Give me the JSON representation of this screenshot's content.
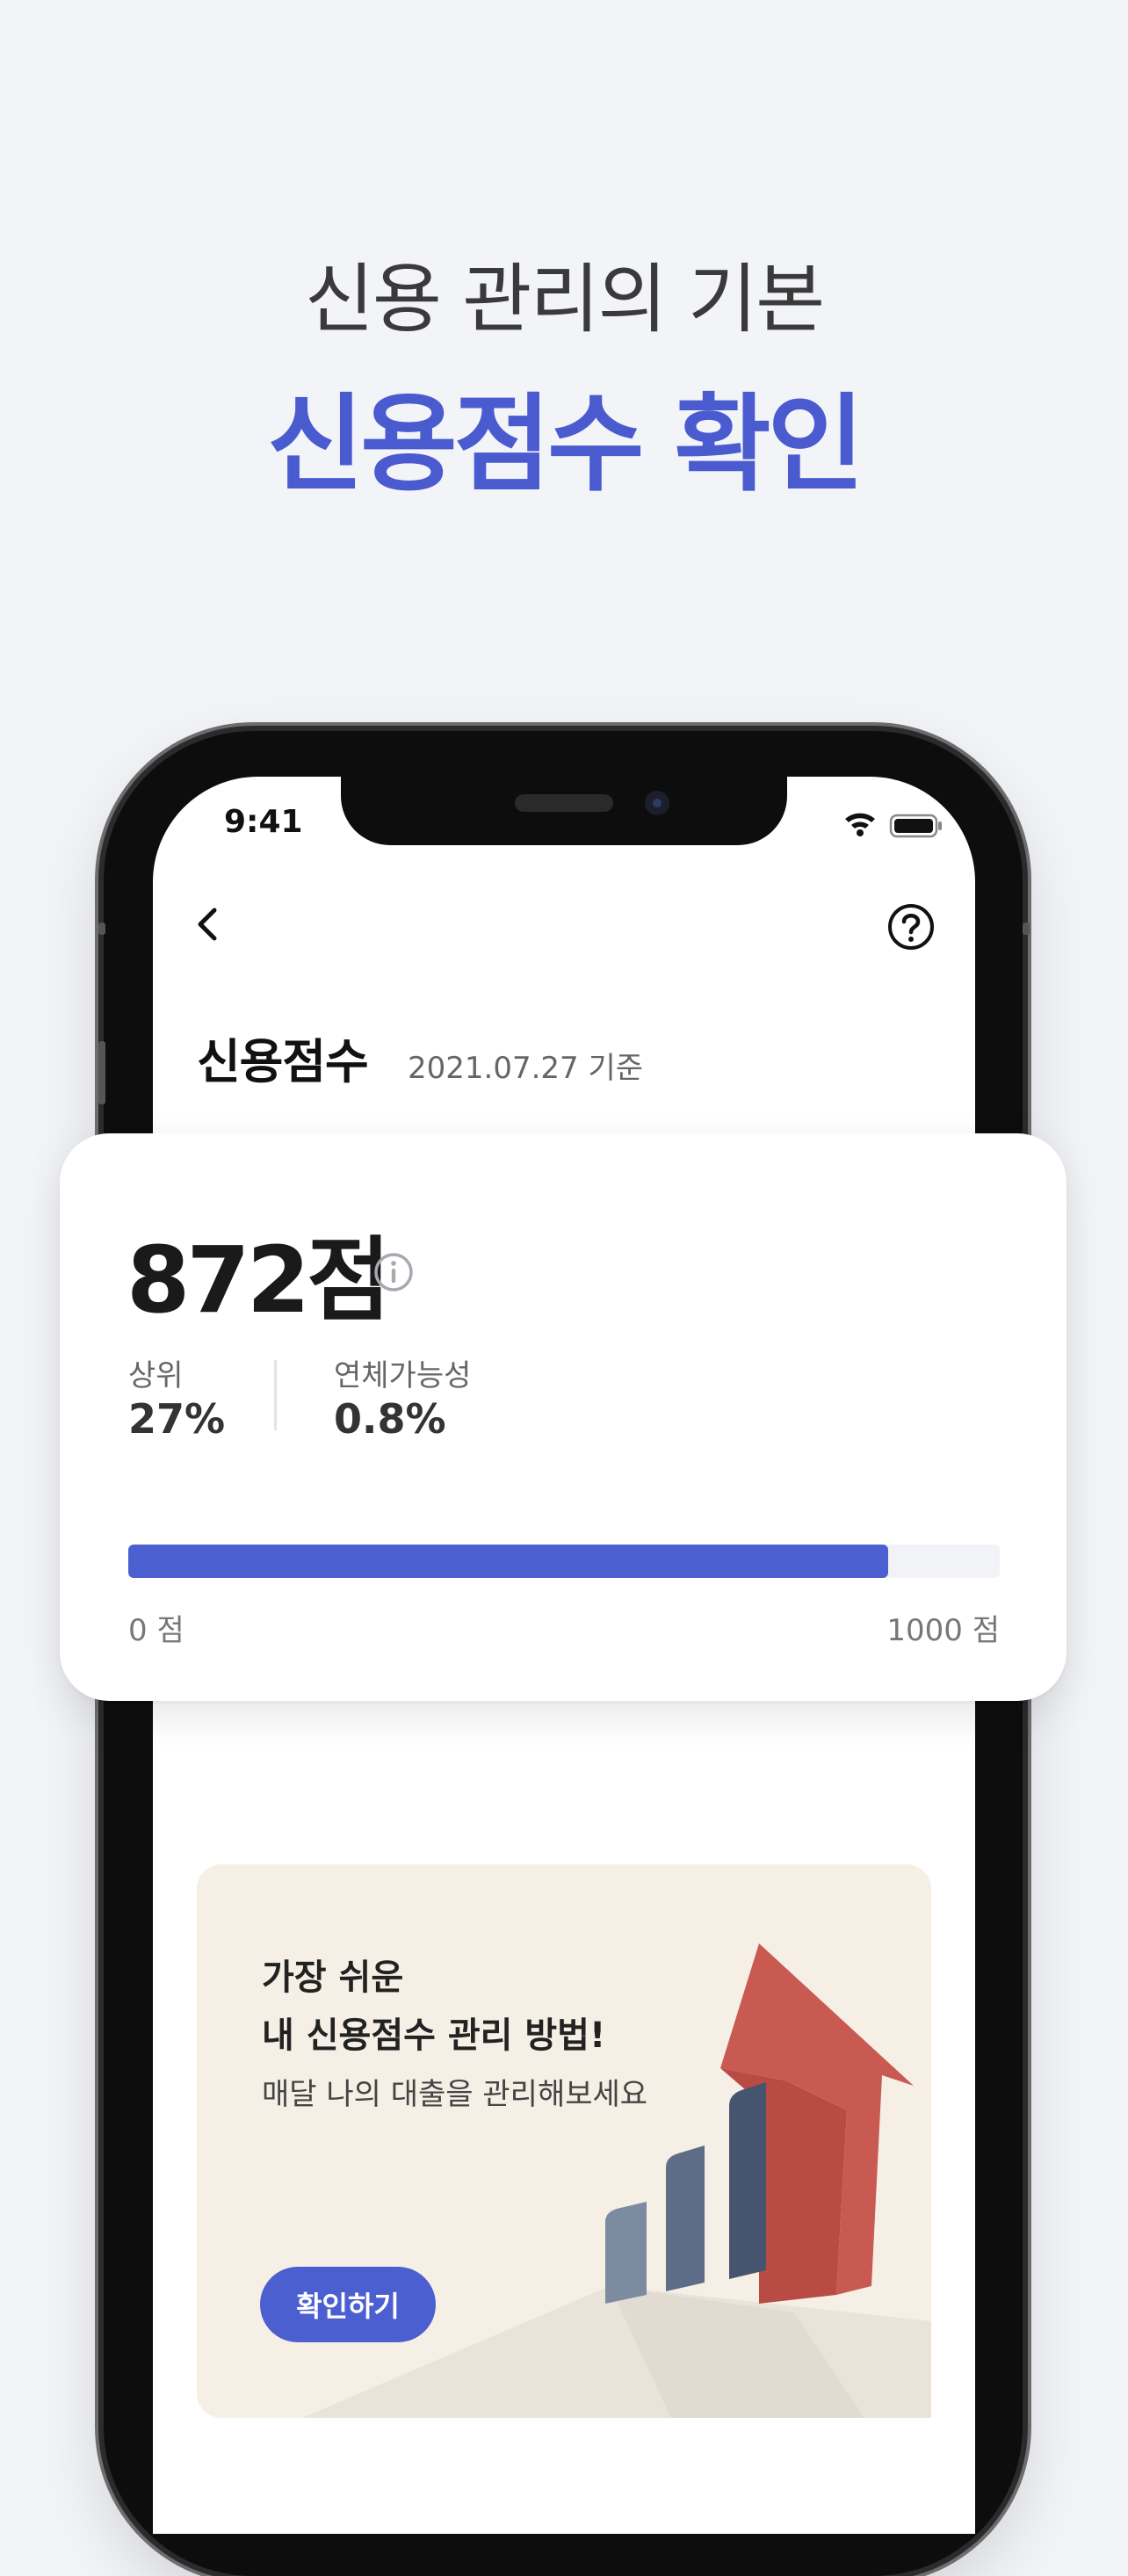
{
  "headline": {
    "sub": "신용 관리의 기본",
    "main": "신용점수 확인"
  },
  "status_bar": {
    "time": "9:41"
  },
  "header": {
    "back_icon": "chevron-left-icon",
    "help_icon": "question-circle-icon",
    "title": "신용점수",
    "date": "2021.07.27 기준"
  },
  "score_card": {
    "score": "872점",
    "info_icon": "info-circle-icon",
    "stats": [
      {
        "label": "상위",
        "value": "27%"
      },
      {
        "label": "연체가능성",
        "value": "0.8%"
      }
    ],
    "progress": {
      "value": 872,
      "min": 0,
      "max": 1000
    },
    "min_label": "0 점",
    "max_label": "1000 점"
  },
  "banner": {
    "title_line1": "가장 쉬운",
    "title_line2": "내 신용점수 관리 방법!",
    "description": "매달 나의 대출을 관리해보세요",
    "button_label": "확인하기"
  },
  "colors": {
    "accent": "#4b5fd1",
    "banner_bg": "#f6efe5",
    "arrow": "#c95a52",
    "bars": "#4f607c"
  }
}
